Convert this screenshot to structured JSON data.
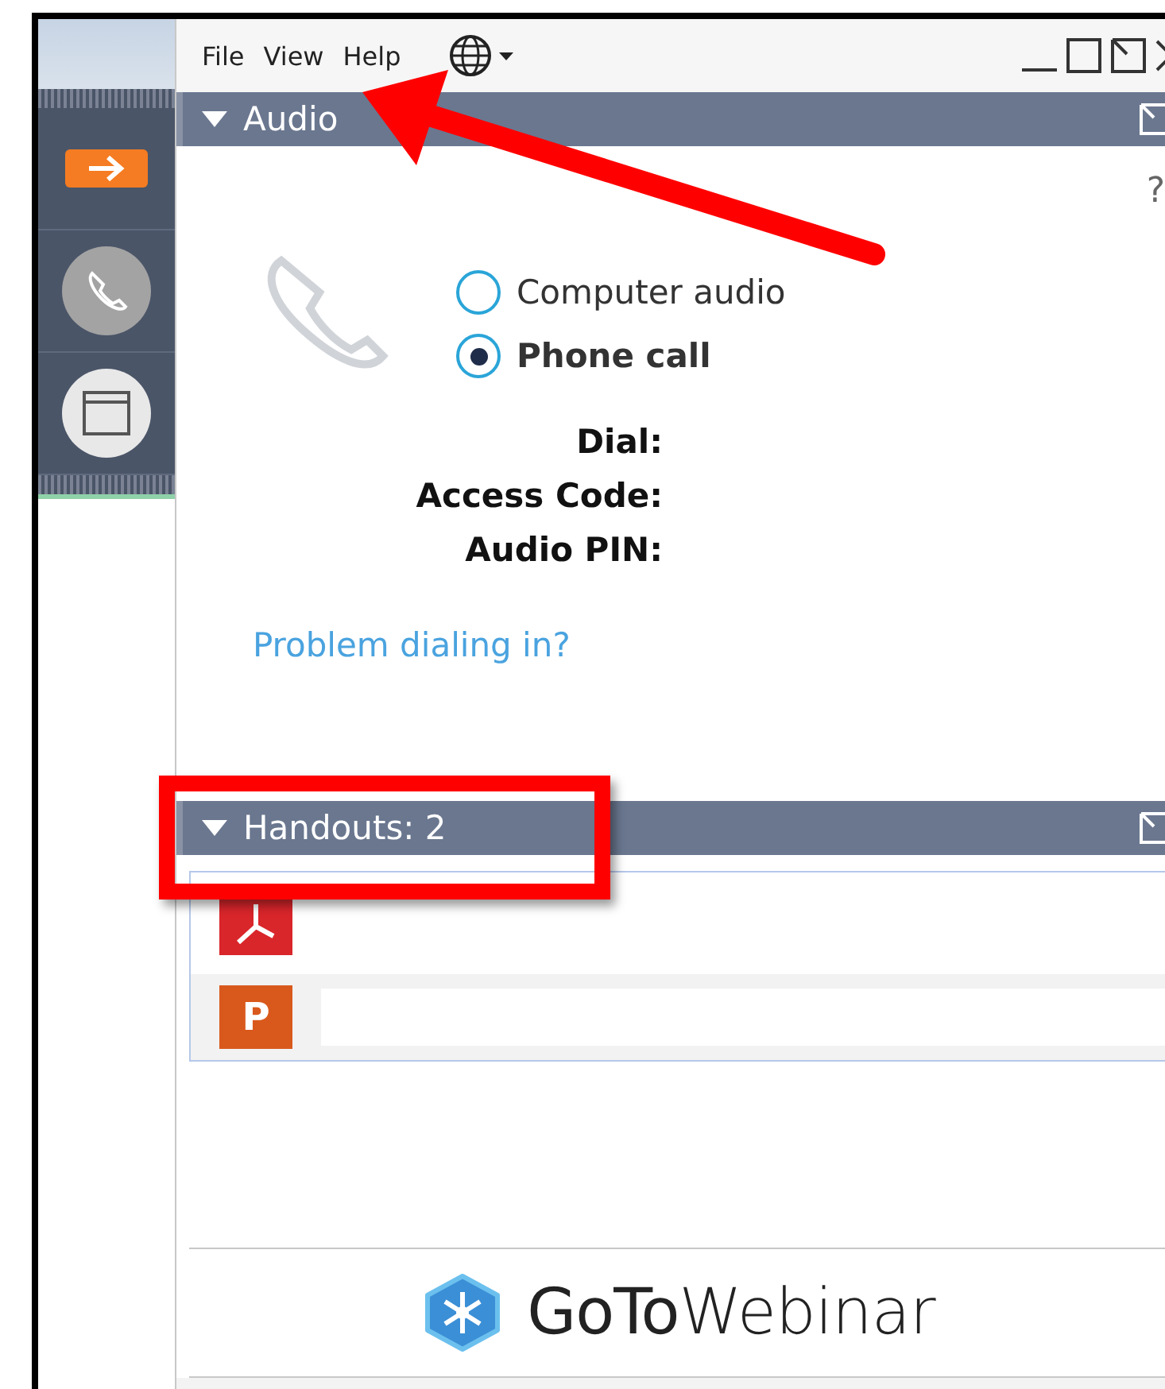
{
  "menu": [
    {
      "label": "File"
    },
    {
      "label": "View"
    },
    {
      "label": "Help"
    }
  ],
  "audio": {
    "title": "Audio",
    "expanded": true,
    "help": "?",
    "options": [
      {
        "label": "Computer audio",
        "selected": false
      },
      {
        "label": "Phone call",
        "selected": true
      }
    ],
    "fields": [
      {
        "label": "Dial:"
      },
      {
        "label": "Access Code:"
      },
      {
        "label": "Audio PIN:"
      }
    ],
    "link": "Problem dialing in?"
  },
  "handouts": {
    "title": "Handouts: 2",
    "expanded": true,
    "items": [
      {
        "kind": "pdf"
      },
      {
        "kind": "ppt",
        "label": "P"
      }
    ]
  },
  "logo": "**GoTo**Webinar"
}
